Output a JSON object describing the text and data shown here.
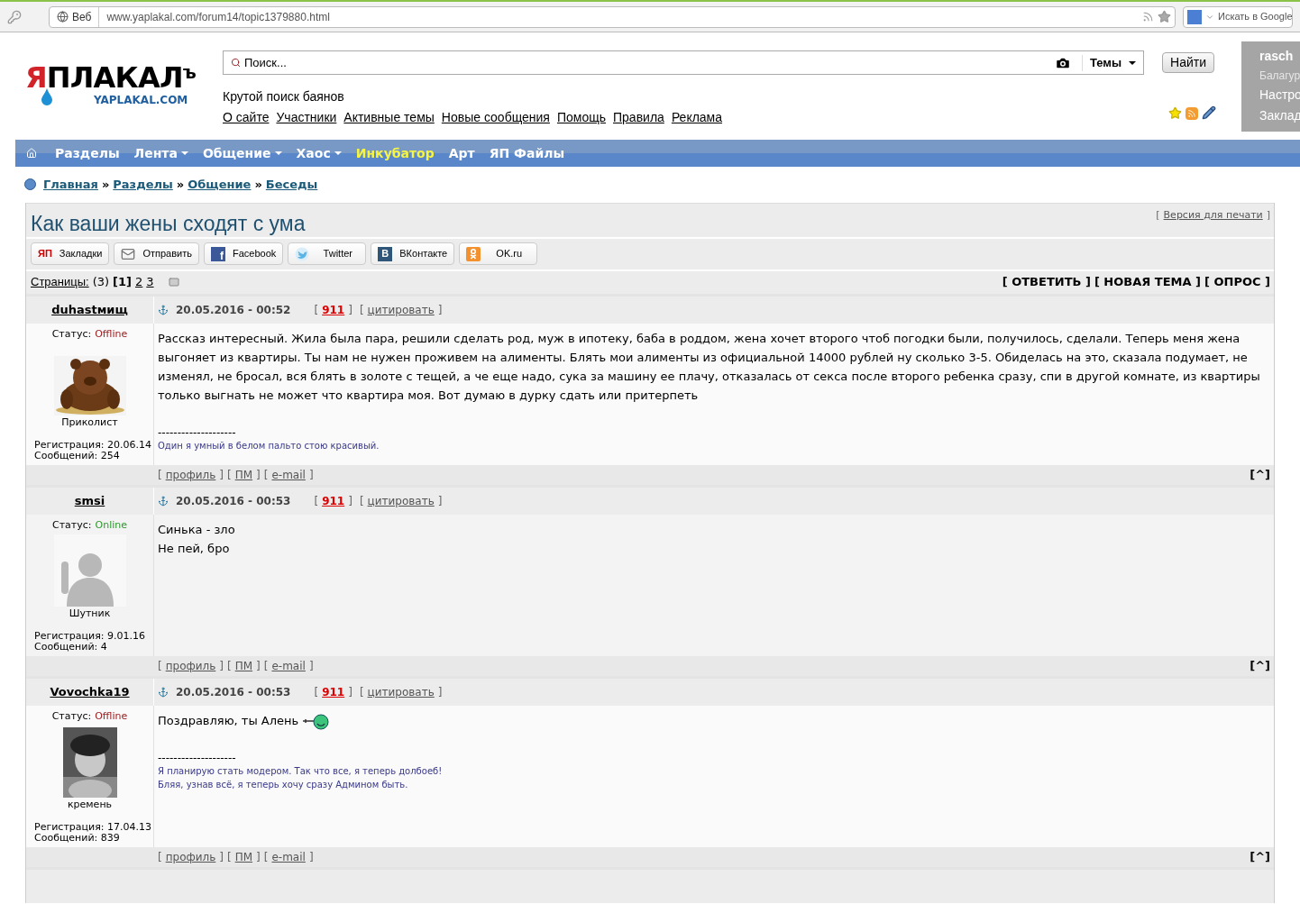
{
  "browser": {
    "site_label": "Веб",
    "url": "www.yaplakal.com/forum14/topic1379880.html",
    "search_placeholder": "Искать в Google"
  },
  "header": {
    "logo": {
      "red": "Я",
      "black": "ПЛАКАЛ",
      "tail": "ъ",
      "sub": "YAPLAKAL.COM"
    },
    "search": {
      "placeholder": "Поиск...",
      "scope": "Темы",
      "button": "Найти"
    },
    "tagline": "Крутой поиск баянов",
    "links": [
      "О сайте",
      "Участники",
      "Активные темы",
      "Новые сообщения",
      "Помощь",
      "Правила",
      "Реклама"
    ],
    "user_panel": {
      "name": "rasch",
      "rank": "Балагур",
      "links": [
        "Настро",
        "Заклад"
      ]
    }
  },
  "nav": [
    {
      "label": "Разделы",
      "dropdown": false,
      "highlighted": false
    },
    {
      "label": "Лента",
      "dropdown": true,
      "highlighted": false
    },
    {
      "label": "Общение",
      "dropdown": true,
      "highlighted": false
    },
    {
      "label": "Хаос",
      "dropdown": true,
      "highlighted": false
    },
    {
      "label": "Инкубатор",
      "dropdown": false,
      "highlighted": true
    },
    {
      "label": "Арт",
      "dropdown": false,
      "highlighted": false
    },
    {
      "label": "ЯП Файлы",
      "dropdown": false,
      "highlighted": false
    }
  ],
  "breadcrumb": [
    {
      "label": "Главная"
    },
    {
      "sep": "»",
      "label": "Разделы"
    },
    {
      "sep": "»",
      "label": "Общение"
    },
    {
      "sep": "»",
      "label": "Беседы"
    }
  ],
  "topic": {
    "title": "Как ваши жены сходят с ума",
    "print": {
      "l": "[",
      "label": "Версия для печати",
      "r": "]"
    },
    "share": [
      {
        "kind": "yp",
        "icon_text": "ЯП",
        "label": "Закладки"
      },
      {
        "kind": "mail",
        "label": "Отправить"
      },
      {
        "kind": "fb",
        "icon_text": "f",
        "label": "Facebook"
      },
      {
        "kind": "tw",
        "label": "Twitter"
      },
      {
        "kind": "vk",
        "icon_text": "В",
        "label": "ВКонтакте"
      },
      {
        "kind": "ok",
        "label": "OK.ru"
      }
    ],
    "pages": {
      "label": "Страницы:",
      "count": "(3)",
      "items": [
        {
          "label": "[1]",
          "selected": true
        },
        {
          "label": "2",
          "selected": false
        },
        {
          "label": "3",
          "selected": false
        }
      ]
    },
    "actions": [
      "[ ОТВЕТИТЬ ]",
      "[ НОВАЯ ТЕМА ]",
      "[ ОПРОС ]"
    ]
  },
  "posts": [
    {
      "author": "duhastмищ",
      "date": "20.05.2016 - 00:52",
      "number": {
        "l": "[",
        "label": "911",
        "r": "]"
      },
      "quote": {
        "l": "[",
        "label": "цитировать",
        "r": "]"
      },
      "status_label": "Статус:",
      "status": "Offline",
      "online": false,
      "avatar": {
        "kind": "picture"
      },
      "rank": "Приколист",
      "registration": "Регистрация: 20.06.14",
      "messages": "Сообщений: 254",
      "body": [
        "Рассказ интересный. Жила была пара, решили сделать род, муж в ипотеку, баба в роддом, жена хочет второго чтоб погодки были, получилось, сделали. Теперь меня жена выгоняет из квартиры. Ты нам не нужен проживем на алименты. Блять мои алименты из официальной 14000 рублей ну сколько 3-5. Обиделась на это, сказала подумает, не изменял, не бросал, вся блять в золоте с тещей, а че еще надо, сука за машину ее плачу, отказалась от секса после второго ребенка сразу, спи в другой комнате, из квартиры только выгнать не может что квартира моя. Вот думаю в дурку сдать или притерпеть"
      ],
      "smiley": false,
      "signature_rule": "--------------------",
      "signature": [
        "Один я умный в белом пальто стою красивый."
      ],
      "footer": [
        {
          "l": "[",
          "label": "профиль",
          "r": "]"
        },
        {
          "l": "[",
          "label": "ПМ",
          "r": "]"
        },
        {
          "l": "[",
          "label": "e-mail",
          "r": "]"
        }
      ],
      "top": "[^]"
    },
    {
      "author": "smsi",
      "date": "20.05.2016 - 00:53",
      "number": {
        "l": "[",
        "label": "911",
        "r": "]"
      },
      "quote": {
        "l": "[",
        "label": "цитировать",
        "r": "]"
      },
      "status_label": "Статус:",
      "status": "Online",
      "online": true,
      "avatar": {
        "kind": "picture"
      },
      "rank": "Шутник",
      "registration": "Регистрация: 9.01.16",
      "messages": "Сообщений: 4",
      "body": [
        "Синька - зло",
        "Не пей, бро"
      ],
      "smiley": false,
      "footer": [
        {
          "l": "[",
          "label": "профиль",
          "r": "]"
        },
        {
          "l": "[",
          "label": "ПМ",
          "r": "]"
        },
        {
          "l": "[",
          "label": "e-mail",
          "r": "]"
        }
      ],
      "top": "[^]"
    },
    {
      "author": "Vovochka19",
      "date": "20.05.2016 - 00:53",
      "number": {
        "l": "[",
        "label": "911",
        "r": "]"
      },
      "quote": {
        "l": "[",
        "label": "цитировать",
        "r": "]"
      },
      "status_label": "Статус:",
      "status": "Offline",
      "online": false,
      "avatar": {
        "kind": "picture"
      },
      "rank": "кремень",
      "registration": "Регистрация: 17.04.13",
      "messages": "Сообщений: 839",
      "body": [
        "Поздравляю, ты Алень"
      ],
      "smiley": true,
      "signature_rule": "--------------------",
      "signature": [
        "Я планирую стать модером. Так что все, я теперь долбоеб!",
        "Бляя, узнав всё, я теперь хочу сразу Админом быть."
      ],
      "footer": [
        {
          "l": "[",
          "label": "профиль",
          "r": "]"
        },
        {
          "l": "[",
          "label": "ПМ",
          "r": "]"
        },
        {
          "l": "[",
          "label": "e-mail",
          "r": "]"
        }
      ],
      "top": "[^]"
    }
  ]
}
